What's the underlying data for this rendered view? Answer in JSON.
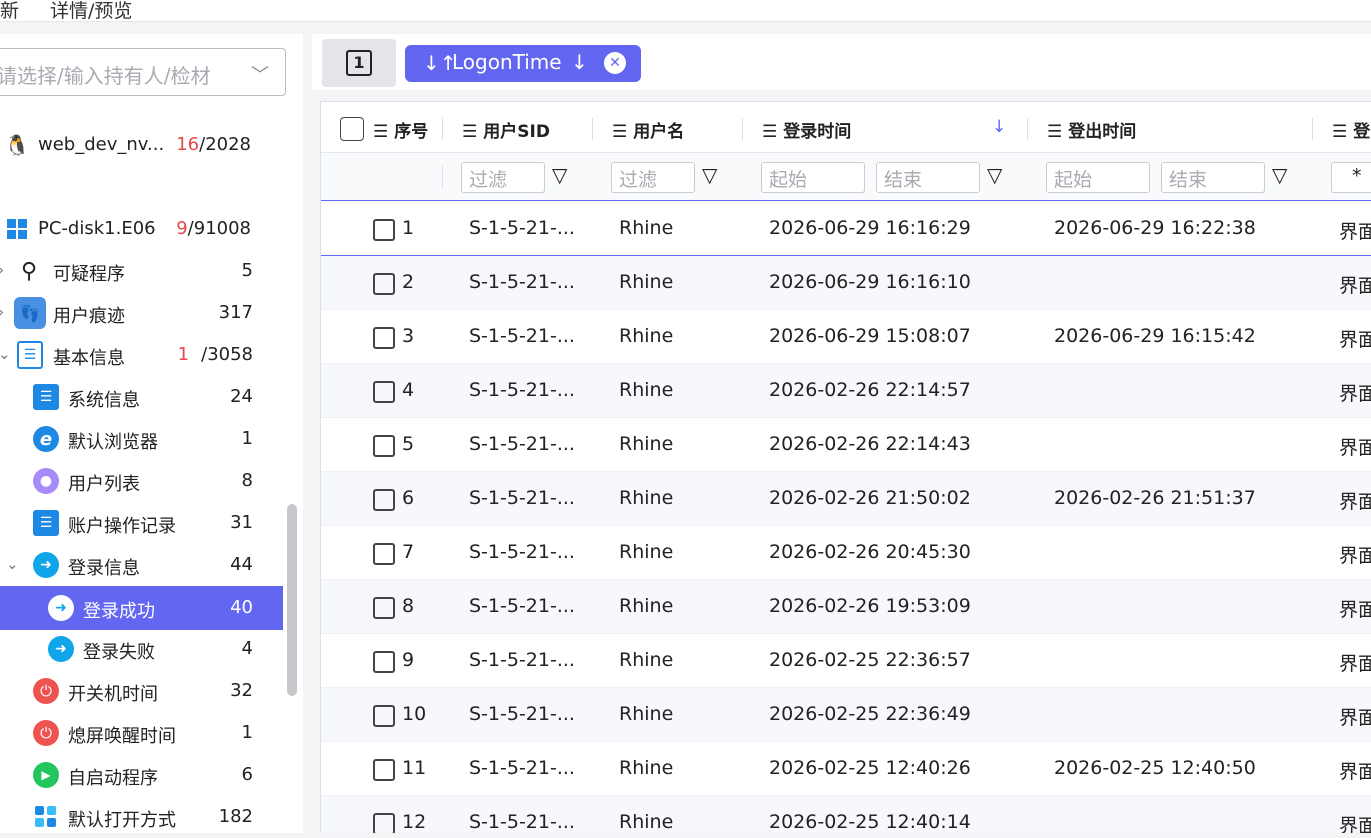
{
  "topbar": {
    "tab1": "新",
    "tab2": "详情/预览"
  },
  "sidebar": {
    "select_placeholder": "请选择/输入持有人/检材",
    "items": [
      {
        "label": "web_dev_nv...",
        "count_hit": "16",
        "count_total": "/2028",
        "icon": "linux-penguin-icon"
      },
      {
        "label": "PC-disk1.E06",
        "count_hit": "9",
        "count_total": "/91008",
        "icon": "windows-icon"
      },
      {
        "label": "可疑程序",
        "count": "5",
        "icon": "suspicious-search-icon"
      },
      {
        "label": "用户痕迹",
        "count": "317",
        "icon": "footprints-icon"
      },
      {
        "label": "基本信息",
        "count_hit": "1",
        "count_total": "/3058",
        "icon": "list-icon"
      },
      {
        "label": "系统信息",
        "count": "24",
        "icon": "system-info-icon"
      },
      {
        "label": "默认浏览器",
        "count": "1",
        "icon": "ie-browser-icon"
      },
      {
        "label": "用户列表",
        "count": "8",
        "icon": "user-icon"
      },
      {
        "label": "账户操作记录",
        "count": "31",
        "icon": "account-log-icon"
      },
      {
        "label": "登录信息",
        "count": "44",
        "icon": "login-arrow-icon"
      },
      {
        "label": "登录成功",
        "count": "40",
        "icon": "login-arrow-icon"
      },
      {
        "label": "登录失败",
        "count": "4",
        "icon": "login-arrow-icon"
      },
      {
        "label": "开关机时间",
        "count": "32",
        "icon": "power-icon"
      },
      {
        "label": "熄屏唤醒时间",
        "count": "1",
        "icon": "power-icon"
      },
      {
        "label": "自启动程序",
        "count": "6",
        "icon": "play-icon"
      },
      {
        "label": "默认打开方式",
        "count": "182",
        "icon": "apps-grid-icon"
      }
    ]
  },
  "toolbar": {
    "page_label": "1",
    "sort_label": "LogonTime",
    "sort_arrow": "↓",
    "sort_icon": "↓↑",
    "clear": "✕"
  },
  "table": {
    "headers": {
      "seq": "序号",
      "sid": "用户SID",
      "name": "用户名",
      "logon": "登录时间",
      "logoff": "登出时间",
      "more": "登"
    },
    "filter": {
      "filter": "过滤",
      "start": "起始",
      "end": "结束",
      "star": "*"
    },
    "rows": [
      {
        "no": "1",
        "sid": "S-1-5-21-...",
        "name": "Rhine",
        "logon": "2026-06-29 16:16:29",
        "logoff": "2026-06-29 16:22:38",
        "more": "界面"
      },
      {
        "no": "2",
        "sid": "S-1-5-21-...",
        "name": "Rhine",
        "logon": "2026-06-29 16:16:10",
        "logoff": "",
        "more": "界面"
      },
      {
        "no": "3",
        "sid": "S-1-5-21-...",
        "name": "Rhine",
        "logon": "2026-06-29 15:08:07",
        "logoff": "2026-06-29 16:15:42",
        "more": "界面"
      },
      {
        "no": "4",
        "sid": "S-1-5-21-...",
        "name": "Rhine",
        "logon": "2026-02-26 22:14:57",
        "logoff": "",
        "more": "界面"
      },
      {
        "no": "5",
        "sid": "S-1-5-21-...",
        "name": "Rhine",
        "logon": "2026-02-26 22:14:43",
        "logoff": "",
        "more": "界面"
      },
      {
        "no": "6",
        "sid": "S-1-5-21-...",
        "name": "Rhine",
        "logon": "2026-02-26 21:50:02",
        "logoff": "2026-02-26 21:51:37",
        "more": "界面"
      },
      {
        "no": "7",
        "sid": "S-1-5-21-...",
        "name": "Rhine",
        "logon": "2026-02-26 20:45:30",
        "logoff": "",
        "more": "界面"
      },
      {
        "no": "8",
        "sid": "S-1-5-21-...",
        "name": "Rhine",
        "logon": "2026-02-26 19:53:09",
        "logoff": "",
        "more": "界面"
      },
      {
        "no": "9",
        "sid": "S-1-5-21-...",
        "name": "Rhine",
        "logon": "2026-02-25 22:36:57",
        "logoff": "",
        "more": "界面"
      },
      {
        "no": "10",
        "sid": "S-1-5-21-...",
        "name": "Rhine",
        "logon": "2026-02-25 22:36:49",
        "logoff": "",
        "more": "界面"
      },
      {
        "no": "11",
        "sid": "S-1-5-21-...",
        "name": "Rhine",
        "logon": "2026-02-25 12:40:26",
        "logoff": "2026-02-25 12:40:50",
        "more": "界面"
      },
      {
        "no": "12",
        "sid": "S-1-5-21-...",
        "name": "Rhine",
        "logon": "2026-02-25 12:40:14",
        "logoff": "",
        "more": "界面"
      }
    ]
  },
  "colors": {
    "accent": "#6366f1",
    "hit": "#e5484d"
  }
}
